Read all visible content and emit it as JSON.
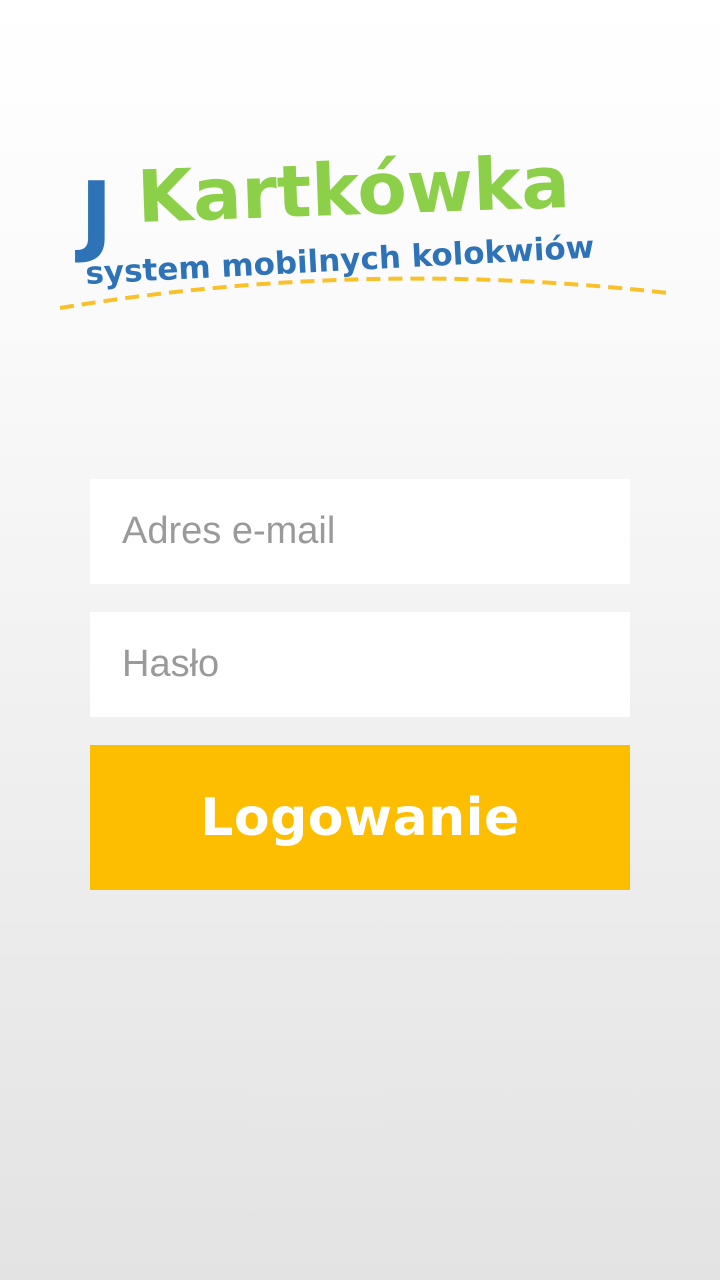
{
  "logo": {
    "letter_j": "J",
    "name": "Kartkówka",
    "tagline": "system mobilnych kolokwiów"
  },
  "form": {
    "email_placeholder": "Adres e-mail",
    "email_value": "",
    "password_placeholder": "Hasło",
    "password_value": "",
    "login_label": "Logowanie"
  },
  "colors": {
    "brand_blue": "#2e72b8",
    "brand_green": "#8ccf48",
    "accent_yellow": "#fdbd00",
    "dash_yellow": "#f8c12a",
    "input_background": "#ffffff",
    "placeholder_text": "#9a9a9a",
    "button_text": "#ffffff"
  }
}
